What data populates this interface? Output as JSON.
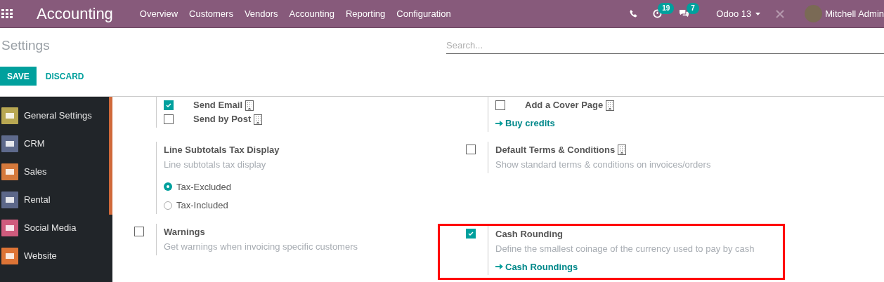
{
  "navbar": {
    "app_title": "Accounting",
    "menu": [
      "Overview",
      "Customers",
      "Vendors",
      "Accounting",
      "Reporting",
      "Configuration"
    ],
    "activity_badge": "19",
    "chat_badge": "7",
    "company": "Odoo 13",
    "user": "Mitchell Admin"
  },
  "control_panel": {
    "title": "Settings",
    "search": {
      "placeholder": "Search..."
    },
    "buttons": [
      {
        "label": "SAVE",
        "kind": "primary"
      },
      {
        "label": "DISCARD",
        "kind": "link"
      }
    ]
  },
  "sidebar": {
    "items": [
      {
        "label": "General Settings",
        "color": "#b8a752"
      },
      {
        "label": "CRM",
        "color": "#5e6a8c"
      },
      {
        "label": "Sales",
        "color": "#d5793c"
      },
      {
        "label": "Rental",
        "color": "#5c6789"
      },
      {
        "label": "Social Media",
        "color": "#cf5b7d"
      },
      {
        "label": "Website",
        "color": "#dd7436"
      }
    ]
  },
  "rows": [
    {
      "left": {
        "kind": "options",
        "options": [
          {
            "label": "Send Email",
            "checked": true,
            "company_icon": true
          },
          {
            "label": "Send by Post",
            "checked": false,
            "company_icon": true
          }
        ]
      },
      "right": {
        "kind": "options",
        "options": [
          {
            "label": "Add a Cover Page",
            "checked": false,
            "company_icon": true
          }
        ],
        "link": "Buy credits"
      }
    },
    {
      "left": {
        "kind": "radio",
        "title": "Line Subtotals Tax Display",
        "description": "Line subtotals tax display",
        "choices": [
          {
            "label": "Tax-Excluded",
            "selected": true
          },
          {
            "label": "Tax-Included",
            "selected": false
          }
        ]
      },
      "right": {
        "kind": "checkbox",
        "checked": false,
        "title": "Default Terms & Conditions",
        "company_icon": true,
        "description": "Show standard terms & conditions on invoices/orders"
      }
    },
    {
      "left": {
        "kind": "checkbox",
        "checked": false,
        "title": "Warnings",
        "description": "Get warnings when invoicing specific customers"
      },
      "right": {
        "kind": "checkbox",
        "checked": true,
        "title": "Cash Rounding",
        "description": "Define the smallest coinage of the currency used to pay by cash",
        "link": "Cash Roundings",
        "highlighted": true
      }
    }
  ]
}
